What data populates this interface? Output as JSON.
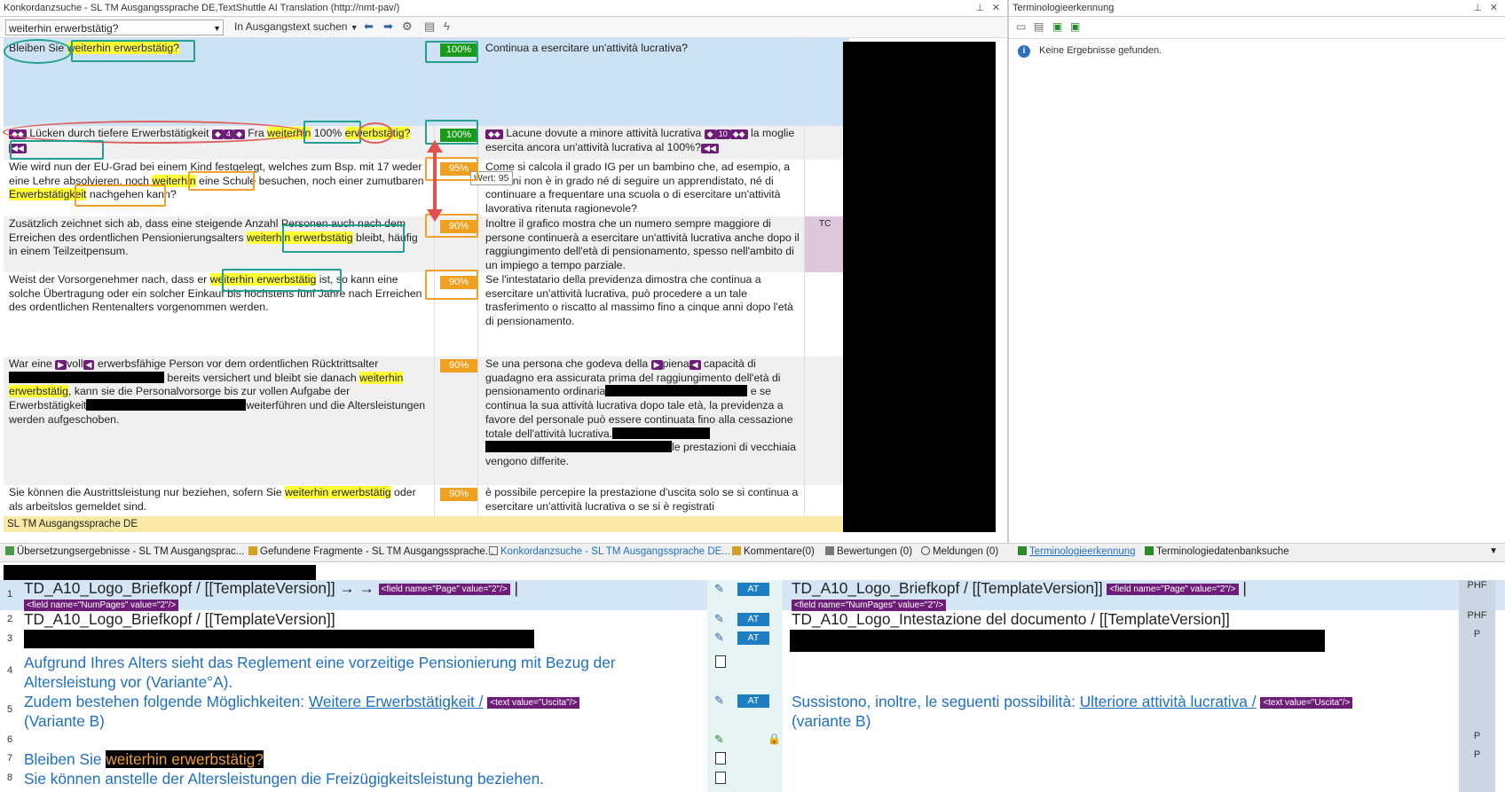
{
  "concordance": {
    "title": "Konkordanzsuche - SL TM Ausgangssprache DE,TextShuttle AI Translation (http://nmt-pav/)",
    "search_value": "weiterhin erwerbstätig?",
    "scope_label": "In Ausgangstext suchen",
    "footer": "SL TM Ausgangssprache DE",
    "tooltip": "Wert: 95",
    "tc_label": "TC",
    "rows": [
      {
        "src_a": "Bleiben Sie ",
        "src_hl": "weiterhin erwerbstätig?",
        "src_b": "",
        "score": "100%",
        "tgt": "Continua a esercitare un'attività lucrativa?"
      },
      {
        "src_a": "Lücken durch tiefere Erwerbstätigkeit ",
        "tag": "4",
        "src_b": " Fra ",
        "src_hl": "weiterhin",
        "src_c": " 100% ",
        "src_hl2": "erwerbstätig?",
        "score": "100%",
        "tgt_a": "Lacune dovute a minore attività lucrativa ",
        "tgt_tag": "10",
        "tgt_b": " la moglie esercita ancora un'attività lucrativa al 100%?"
      },
      {
        "src_a": "Wie wird nun der EU-Grad bei einem Kind festgelegt, welches zum Bsp. mit 17 weder eine Lehre absolvieren, noch ",
        "src_hl": "weiterhin",
        "src_b": " eine Schule besuchen, noch einer zumutbaren ",
        "src_hl2": "Erwerbstätigkeit",
        "src_c": " nachgehen kann?",
        "score": "95%",
        "tgt": "Come si calcola il grado IG per un bambino che, ad esempio, a 17 anni non è in grado né di seguire un apprendistato, né di continuare a frequentare una scuola o di esercitare un'attività lavorativa ritenuta ragionevole?"
      },
      {
        "src_a": "Zusätzlich zeichnet sich ab, dass eine steigende Anzahl Personen auch nach dem Erreichen des ordentlichen Pensionierungsalters ",
        "src_hl": "weiterhin erwerbstätig",
        "src_b": " bleibt, häufig in einem Teilzeitpensum.",
        "score": "90%",
        "tgt": "Inoltre il grafico mostra che un numero sempre maggiore di persone continuerà a esercitare un'attività lucrativa anche dopo il raggiungimento dell'età di pensionamento, spesso nell'ambito di un impiego a tempo parziale."
      },
      {
        "src_a": "Weist der Vorsorgenehmer nach, dass er ",
        "src_hl": "weiterhin erwerbstätig",
        "src_b": " ist, so kann eine solche Übertragung oder ein solcher Einkauf bis höchstens fünf Jahre nach Erreichen des ordentlichen Rentenalters vorgenommen werden.",
        "score": "90%",
        "tgt": "Se l'intestatario della previdenza dimostra che continua a esercitare un'attività lucrativa, può procedere a un tale trasferimento o riscatto al massimo fino a cinque anni dopo l'età di pensionamento."
      },
      {
        "src_a": "War eine ",
        "src_b": "voll",
        "src_c": " erwerbsfähige Person vor dem ordentlichen Rücktrittsalter",
        "src_d": " bereits versichert und bleibt sie danach ",
        "src_hl": "weiterhin erwerbstätig",
        "src_e": ", kann sie die Personalvorsorge bis zur vollen Aufgabe der Erwerbstätigkeit",
        "src_f": "weiterführen und die Altersleistungen werden aufgeschoben.",
        "score": "90%",
        "tgt_a": "Se una persona che godeva della ",
        "tgt_b": "piena",
        "tgt_c": " capacità di guadagno era assicurata prima del raggiungimento dell'età di pensionamento ordinaria",
        "tgt_d": " e se continua la sua attività lucrativa dopo tale età, la previdenza a favore del personale può essere continuata fino alla cessazione totale dell'attività lucrativa.",
        "tgt_e": "le prestazioni di vecchiaia vengono differite."
      },
      {
        "src_a": "Sie können die Austrittsleistung nur beziehen, sofern Sie ",
        "src_hl": "weiterhin erwerbstätig",
        "src_b": " oder als arbeitslos gemeldet sind.",
        "score": "90%",
        "tgt": "è possibile percepire la prestazione d'uscita solo se si continua a esercitare un'attività lucrativa o se si è registrati"
      }
    ]
  },
  "terminology": {
    "title": "Terminologieerkennung",
    "message": "Keine Ergebnisse gefunden."
  },
  "tabs": [
    {
      "label": "Übersetzungsergebnisse - SL TM Ausgangsprac..."
    },
    {
      "label": "Gefundene Fragmente - SL TM Ausgangssprache..."
    },
    {
      "label": "Konkordanzsuche - SL TM Ausgangssprache DE..."
    },
    {
      "label": "Kommentare(0)"
    },
    {
      "label": "Bewertungen (0)"
    },
    {
      "label": "Meldungen (0)"
    },
    {
      "label": "Terminologieerkennung"
    },
    {
      "label": "Terminologiedatenbanksuche"
    }
  ],
  "editor": {
    "at_label": "AT",
    "rows": [
      {
        "n": "1",
        "src": "TD_A10_Logo_Briefkopf / [[TemplateVersion]] → →",
        "src_tag": "<field name=\"Page\" value=\"2\"/>",
        "src_tag2": "<field name=\"NumPages\" value=\"2\"/>",
        "tgt": "TD_A10_Logo_Briefkopf / [[TemplateVersion]]",
        "tgt_tag": "<field name=\"Page\" value=\"2\"/>",
        "tgt_tag2": "<field name=\"NumPages\" value=\"2\"/>",
        "phf": "PHF"
      },
      {
        "n": "2",
        "src": "TD_A10_Logo_Briefkopf / [[TemplateVersion]]",
        "tgt": "TD_A10_Logo_Intestazione del documento / [[TemplateVersion]]",
        "phf": "PHF"
      },
      {
        "n": "3",
        "phf": "P"
      },
      {
        "n": "4",
        "src": "Aufgrund Ihres Alters sieht das Reglement eine vorzeitige Pensionierung mit Bezug der Altersleistung vor (Variante°A)."
      },
      {
        "n": "5",
        "src_a": "Zudem bestehen folgende Möglichkeiten: ",
        "src_link": "Weitere Erwerbstätigkeit /",
        "src_tag": "<text value=\"Uscita\"/>",
        "src_b": "(Variante B)",
        "tgt_a": "Sussistono, inoltre, le seguenti possibilità: ",
        "tgt_link": "Ulteriore attività lucrativa /",
        "tgt_tag": "<text value=\"Uscita\"/>",
        "tgt_b": "(variante B)"
      },
      {
        "n": "6",
        "phf": "P"
      },
      {
        "n": "7",
        "src_a": "Bleiben Sie ",
        "src_hl": "weiterhin erwerbstätig?",
        "phf": "P"
      },
      {
        "n": "8",
        "src": "Sie können anstelle der Altersleistungen die Freizügigkeitsleistung beziehen."
      }
    ]
  }
}
